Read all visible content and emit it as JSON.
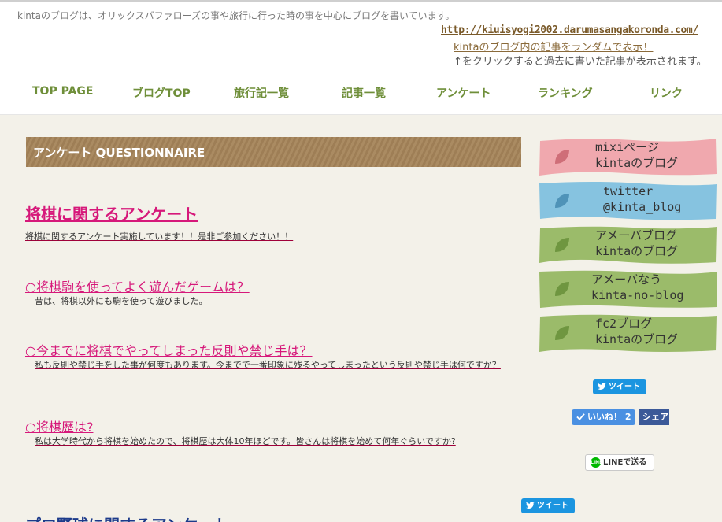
{
  "header": {
    "description": "kintaのブログは、オリックスバファローズの事や旅行に行った時の事を中心にブログを書いています。",
    "site_url": "http://kiuisyogi2002.darumasangakoronda.com/",
    "random_link": "kintaのブログ内の記事をランダムで表示！",
    "click_note": "↑をクリックすると過去に書いた記事が表示されます。"
  },
  "nav": {
    "items": [
      "TOP PAGE",
      "ブログTOP",
      "旅行記一覧",
      "記事一覧",
      "アンケート",
      "ランキング",
      "リンク"
    ]
  },
  "main": {
    "section_title": "アンケート  QUESTIONNAIRE",
    "survey_title": "将棋に関するアンケート",
    "survey_intro": "将棋に関するアンケート実施しています！！是非ご参加ください！！",
    "questions": [
      {
        "title": "○将棋駒を使ってよく遊んだゲームは？",
        "desc": "昔は、将棋以外にも駒を使って遊びました。"
      },
      {
        "title": "○今までに将棋でやってしまった反則や禁じ手は？",
        "desc": "私も反則や禁じ手をした事が何度もあります。今までで一番印象に残るやってしまったという反則や禁じ手は何ですか？"
      },
      {
        "title": "○将棋歴は?",
        "desc": "私は大学時代から将棋を始めたので、将棋歴は大体10年ほどです。皆さんは将棋を始めて何年ぐらいですか?"
      }
    ],
    "next_title": "プロ野球に関するアンケート"
  },
  "sidebar": {
    "items": [
      {
        "line1": "mixiページ",
        "line2": "kintaのブログ",
        "color": "#f0a8ae"
      },
      {
        "line1": "twitter",
        "line2": "@kinta_blog",
        "color": "#86c3e0"
      },
      {
        "line1": "アメーバブログ",
        "line2": "kintaのブログ",
        "color": "#9bbb6a"
      },
      {
        "line1": "アメーバなう",
        "line2": "kinta-no-blog",
        "color": "#9bbb6a"
      },
      {
        "line1": "fc2ブログ",
        "line2": "kintaのブログ",
        "color": "#9bbb6a"
      }
    ]
  },
  "social": {
    "tweet_label": "ツイート",
    "like_label": "いいね！ 2",
    "share_label": "シェア",
    "line_label": "LINEで送る",
    "line_icon_text": "LINE"
  },
  "colors": {
    "nav": "#6f8f3a",
    "accent_pink": "#d6187a",
    "section_bar": "#a6855a",
    "link_brown": "#8a6a3a",
    "twitter": "#1b95e0",
    "facebook": "#3b5998",
    "line": "#00b900"
  }
}
